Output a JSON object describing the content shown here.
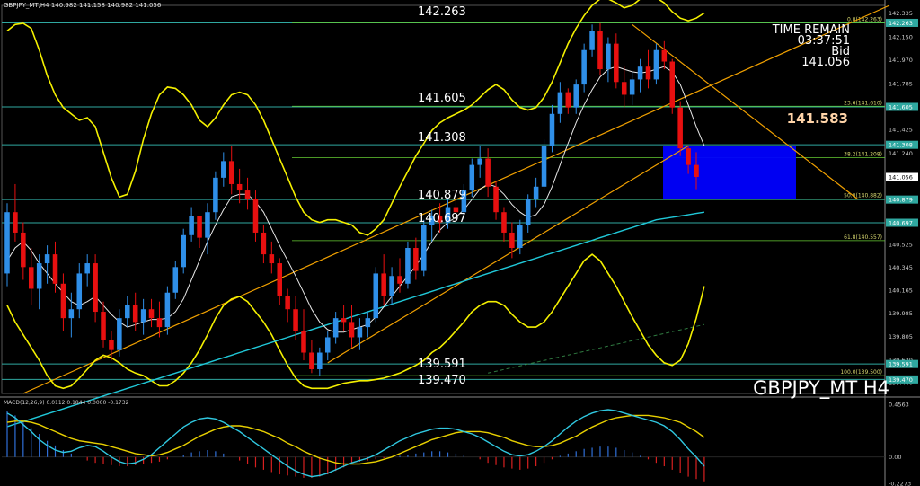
{
  "header": {
    "title": "GBPJPY_MT,H4  140.982 141.158 140.982 141.056"
  },
  "timer": {
    "label": "TIME REMAIN",
    "time": "03:37:51",
    "side": "Bid",
    "price": "141.056"
  },
  "current_price_big": "141.583",
  "symbol": "GBPJPY_MT H4",
  "macd_header": "MACD(12,26,9) 0.0112 0.1844 0.0000 -0.1732",
  "level_labels": [
    "142.263",
    "141.605",
    "141.308",
    "140.879",
    "140.697",
    "139.591",
    "139.470"
  ],
  "fib_labels": [
    "0.0(142.263)",
    "23.6(141.610)",
    "38.2(141.208)",
    "50.0(140.882)",
    "61.8(140.557)",
    "100.0(139.500)"
  ],
  "price_axis": {
    "ticks": [
      "142.335",
      "142.150",
      "141.970",
      "141.785",
      "141.605",
      "141.425",
      "141.240",
      "141.056",
      "140.875",
      "140.690",
      "140.525",
      "140.345",
      "140.165",
      "139.985",
      "139.805",
      "139.620",
      "139.440"
    ],
    "badges": [
      "142.263",
      "141.605",
      "141.308",
      "141.056",
      "140.879",
      "140.697",
      "139.591",
      "139.470"
    ]
  },
  "macd_axis": {
    "ticks": [
      "0.4563",
      "0.00",
      "-0.2273"
    ]
  },
  "colors": {
    "bull": "#2f8fe8",
    "bear": "#e81010",
    "bollinger": "#f4f000",
    "ma_fast": "#e8e8e8",
    "ma_slow": "#20c8d8",
    "trend": "#f0a000",
    "hline": "#2fa8a0",
    "fib": "#66cc33",
    "zone": "#0000ff",
    "macd_signal": "#e8d000",
    "macd_line": "#30c8e0"
  },
  "chart_data": {
    "type": "candlestick",
    "title": "GBPJPY_MT H4",
    "ylim": [
      139.36,
      142.4
    ],
    "levels": [
      142.263,
      141.605,
      141.308,
      140.879,
      140.697,
      139.591,
      139.47
    ],
    "fibonacci": [
      {
        "ratio": 0.0,
        "price": 142.263
      },
      {
        "ratio": 23.6,
        "price": 141.61
      },
      {
        "ratio": 38.2,
        "price": 141.208
      },
      {
        "ratio": 50.0,
        "price": 140.882
      },
      {
        "ratio": 61.8,
        "price": 140.557
      },
      {
        "ratio": 100.0,
        "price": 139.5
      }
    ],
    "candles": [
      [
        140.3,
        140.85,
        140.2,
        140.78
      ],
      [
        140.78,
        141.0,
        140.55,
        140.62
      ],
      [
        140.62,
        140.7,
        140.25,
        140.35
      ],
      [
        140.35,
        140.5,
        140.05,
        140.18
      ],
      [
        140.18,
        140.45,
        140.02,
        140.38
      ],
      [
        140.38,
        140.52,
        140.22,
        140.45
      ],
      [
        140.45,
        140.55,
        140.15,
        140.22
      ],
      [
        140.22,
        140.3,
        139.85,
        139.95
      ],
      [
        139.95,
        140.15,
        139.8,
        140.02
      ],
      [
        140.02,
        140.38,
        139.95,
        140.3
      ],
      [
        140.3,
        140.45,
        140.2,
        140.38
      ],
      [
        140.38,
        140.45,
        139.92,
        140.0
      ],
      [
        140.0,
        140.08,
        139.72,
        139.78
      ],
      [
        139.78,
        139.85,
        139.62,
        139.7
      ],
      [
        139.7,
        140.02,
        139.65,
        139.95
      ],
      [
        139.95,
        140.12,
        139.88,
        140.05
      ],
      [
        140.05,
        140.15,
        139.85,
        139.92
      ],
      [
        139.92,
        140.1,
        139.82,
        140.02
      ],
      [
        140.02,
        140.1,
        139.88,
        139.95
      ],
      [
        139.95,
        140.08,
        139.8,
        139.88
      ],
      [
        139.88,
        140.2,
        139.82,
        140.15
      ],
      [
        140.15,
        140.4,
        140.1,
        140.35
      ],
      [
        140.35,
        140.65,
        140.3,
        140.6
      ],
      [
        140.6,
        140.82,
        140.55,
        140.75
      ],
      [
        140.75,
        140.72,
        140.5,
        140.58
      ],
      [
        140.58,
        140.85,
        140.45,
        140.78
      ],
      [
        140.78,
        141.1,
        140.72,
        141.05
      ],
      [
        141.05,
        141.25,
        140.98,
        141.18
      ],
      [
        141.18,
        141.3,
        140.92,
        141.0
      ],
      [
        141.0,
        141.12,
        140.85,
        140.95
      ],
      [
        140.95,
        141.05,
        140.8,
        140.88
      ],
      [
        140.88,
        140.95,
        140.55,
        140.62
      ],
      [
        140.62,
        140.68,
        140.38,
        140.45
      ],
      [
        140.45,
        140.55,
        140.3,
        140.38
      ],
      [
        140.38,
        140.42,
        140.05,
        140.12
      ],
      [
        140.12,
        140.18,
        139.92,
        140.02
      ],
      [
        140.02,
        140.12,
        139.78,
        139.85
      ],
      [
        139.85,
        140.02,
        139.62,
        139.68
      ],
      [
        139.68,
        139.78,
        139.52,
        139.55
      ],
      [
        139.55,
        139.72,
        139.5,
        139.68
      ],
      [
        139.68,
        139.85,
        139.62,
        139.8
      ],
      [
        139.8,
        140.0,
        139.75,
        139.95
      ],
      [
        139.95,
        140.05,
        139.85,
        139.92
      ],
      [
        139.92,
        140.05,
        139.72,
        139.8
      ],
      [
        139.8,
        139.95,
        139.7,
        139.88
      ],
      [
        139.88,
        140.0,
        139.8,
        139.95
      ],
      [
        139.95,
        140.35,
        139.92,
        140.3
      ],
      [
        140.3,
        140.45,
        140.05,
        140.12
      ],
      [
        140.12,
        140.35,
        140.05,
        140.28
      ],
      [
        140.28,
        140.42,
        140.15,
        140.22
      ],
      [
        140.22,
        140.55,
        140.18,
        140.5
      ],
      [
        140.5,
        140.58,
        140.25,
        140.32
      ],
      [
        140.32,
        140.72,
        140.28,
        140.68
      ],
      [
        140.68,
        140.8,
        140.55,
        140.75
      ],
      [
        140.75,
        140.85,
        140.62,
        140.7
      ],
      [
        140.7,
        140.88,
        140.65,
        140.82
      ],
      [
        140.82,
        140.95,
        140.7,
        140.78
      ],
      [
        140.78,
        141.0,
        140.72,
        140.95
      ],
      [
        140.95,
        141.2,
        140.9,
        141.15
      ],
      [
        141.15,
        141.3,
        141.05,
        141.2
      ],
      [
        141.2,
        141.28,
        140.9,
        140.98
      ],
      [
        140.98,
        141.02,
        140.72,
        140.78
      ],
      [
        140.78,
        140.82,
        140.55,
        140.62
      ],
      [
        140.62,
        140.7,
        140.42,
        140.5
      ],
      [
        140.5,
        140.72,
        140.45,
        140.68
      ],
      [
        140.68,
        140.92,
        140.62,
        140.88
      ],
      [
        140.88,
        141.05,
        140.82,
        140.98
      ],
      [
        140.98,
        141.35,
        140.95,
        141.3
      ],
      [
        141.3,
        141.62,
        141.25,
        141.55
      ],
      [
        141.55,
        141.8,
        141.48,
        141.72
      ],
      [
        141.72,
        141.75,
        141.55,
        141.6
      ],
      [
        141.6,
        141.82,
        141.55,
        141.78
      ],
      [
        141.78,
        142.1,
        141.72,
        142.05
      ],
      [
        142.05,
        142.25,
        142.0,
        142.2
      ],
      [
        142.2,
        142.26,
        141.85,
        141.9
      ],
      [
        141.9,
        142.15,
        141.8,
        142.1
      ],
      [
        142.1,
        142.18,
        141.75,
        141.8
      ],
      [
        141.8,
        141.92,
        141.6,
        141.7
      ],
      [
        141.7,
        141.88,
        141.62,
        141.82
      ],
      [
        141.82,
        141.98,
        141.72,
        141.92
      ],
      [
        141.92,
        142.05,
        141.75,
        141.82
      ],
      [
        141.82,
        142.1,
        141.78,
        142.05
      ],
      [
        142.05,
        142.12,
        141.9,
        141.96
      ],
      [
        141.96,
        141.98,
        141.55,
        141.6
      ],
      [
        141.6,
        141.65,
        141.22,
        141.28
      ],
      [
        141.28,
        141.3,
        141.08,
        141.15
      ],
      [
        141.15,
        141.25,
        140.96,
        141.056
      ]
    ],
    "bollinger_upper": [
      142.2,
      142.25,
      142.26,
      142.22,
      142.05,
      141.85,
      141.7,
      141.6,
      141.55,
      141.5,
      141.52,
      141.45,
      141.25,
      141.05,
      140.9,
      140.92,
      141.1,
      141.35,
      141.55,
      141.7,
      141.76,
      141.75,
      141.7,
      141.62,
      141.5,
      141.45,
      141.52,
      141.62,
      141.7,
      141.72,
      141.7,
      141.62,
      141.5,
      141.35,
      141.2,
      141.05,
      140.9,
      140.78,
      140.72,
      140.7,
      140.72,
      140.72,
      140.7,
      140.68,
      140.62,
      140.6,
      140.65,
      140.72,
      140.85,
      140.98,
      141.1,
      141.22,
      141.32,
      141.42,
      141.48,
      141.52,
      141.55,
      141.58,
      141.62,
      141.68,
      141.74,
      141.78,
      141.74,
      141.66,
      141.6,
      141.58,
      141.6,
      141.68,
      141.8,
      141.95,
      142.1,
      142.22,
      142.32,
      142.4,
      142.45,
      142.45,
      142.42,
      142.38,
      142.4,
      142.45,
      142.48,
      142.46,
      142.42,
      142.35,
      142.3,
      142.28,
      142.3,
      142.34
    ],
    "bollinger_lower": [
      140.05,
      139.92,
      139.82,
      139.72,
      139.62,
      139.5,
      139.42,
      139.4,
      139.42,
      139.48,
      139.55,
      139.62,
      139.66,
      139.64,
      139.6,
      139.55,
      139.52,
      139.5,
      139.46,
      139.42,
      139.42,
      139.46,
      139.52,
      139.6,
      139.7,
      139.82,
      139.95,
      140.05,
      140.1,
      140.12,
      140.08,
      140.0,
      139.92,
      139.82,
      139.7,
      139.58,
      139.48,
      139.42,
      139.4,
      139.4,
      139.4,
      139.42,
      139.44,
      139.45,
      139.46,
      139.46,
      139.47,
      139.48,
      139.5,
      139.52,
      139.55,
      139.58,
      139.62,
      139.68,
      139.72,
      139.78,
      139.85,
      139.92,
      140.0,
      140.05,
      140.08,
      140.08,
      140.05,
      139.98,
      139.92,
      139.88,
      139.88,
      139.92,
      140.0,
      140.1,
      140.2,
      140.3,
      140.4,
      140.45,
      140.4,
      140.3,
      140.2,
      140.08,
      139.96,
      139.85,
      139.74,
      139.66,
      139.6,
      139.58,
      139.62,
      139.75,
      139.95,
      140.2
    ],
    "ma_fast": [
      140.4,
      140.5,
      140.55,
      140.48,
      140.38,
      140.3,
      140.22,
      140.15,
      140.08,
      140.05,
      140.08,
      140.12,
      140.05,
      139.98,
      139.92,
      139.88,
      139.9,
      139.92,
      139.94,
      139.94,
      139.95,
      140.0,
      140.1,
      140.25,
      140.4,
      140.55,
      140.68,
      140.8,
      140.9,
      140.92,
      140.92,
      140.86,
      140.78,
      140.65,
      140.52,
      140.4,
      140.28,
      140.15,
      140.02,
      139.92,
      139.86,
      139.84,
      139.84,
      139.86,
      139.88,
      139.9,
      139.96,
      140.04,
      140.12,
      140.2,
      140.28,
      140.36,
      140.45,
      140.55,
      140.64,
      140.7,
      140.74,
      140.8,
      140.88,
      140.96,
      141.0,
      140.98,
      140.92,
      140.84,
      140.78,
      140.74,
      140.76,
      140.84,
      140.98,
      141.15,
      141.32,
      141.48,
      141.62,
      141.74,
      141.84,
      141.9,
      141.92,
      141.9,
      141.88,
      141.87,
      141.88,
      141.9,
      141.92,
      141.88,
      141.78,
      141.62,
      141.45,
      141.3
    ],
    "ma_slow": [
      139.1,
      139.12,
      139.14,
      139.16,
      139.18,
      139.2,
      139.22,
      139.24,
      139.26,
      139.28,
      139.3,
      139.32,
      139.34,
      139.36,
      139.38,
      139.4,
      139.42,
      139.44,
      139.46,
      139.48,
      139.5,
      139.52,
      139.54,
      139.56,
      139.58,
      139.6,
      139.62,
      139.64,
      139.66,
      139.68,
      139.7,
      139.72,
      139.74,
      139.76,
      139.78,
      139.8,
      139.82,
      139.84,
      139.86,
      139.88,
      139.9,
      139.92,
      139.94,
      139.96,
      139.98,
      140.0,
      140.02,
      140.04,
      140.06,
      140.08,
      140.1,
      140.12,
      140.14,
      140.16,
      140.18,
      140.2,
      140.22,
      140.24,
      140.26,
      140.28,
      140.3,
      140.32,
      140.34,
      140.36,
      140.38,
      140.4,
      140.42,
      140.44,
      140.46,
      140.48,
      140.5,
      140.52,
      140.54,
      140.56,
      140.58,
      140.6,
      140.62,
      140.64,
      140.66,
      140.68,
      140.7,
      140.72,
      140.73,
      140.74,
      140.75,
      140.76,
      140.77,
      140.78
    ],
    "macd_hist": [
      0.38,
      0.34,
      0.28,
      0.22,
      0.15,
      0.1,
      0.06,
      0.04,
      0.05,
      0.08,
      0.1,
      0.09,
      0.05,
      0.0,
      -0.04,
      -0.06,
      -0.05,
      -0.02,
      0.02,
      0.08,
      0.14,
      0.2,
      0.26,
      0.3,
      0.33,
      0.34,
      0.33,
      0.3,
      0.26,
      0.22,
      0.17,
      0.12,
      0.07,
      0.02,
      -0.03,
      -0.08,
      -0.12,
      -0.15,
      -0.17,
      -0.16,
      -0.14,
      -0.11,
      -0.08,
      -0.05,
      -0.03,
      -0.01,
      0.02,
      0.06,
      0.1,
      0.14,
      0.17,
      0.2,
      0.22,
      0.24,
      0.25,
      0.25,
      0.24,
      0.22,
      0.2,
      0.17,
      0.13,
      0.09,
      0.05,
      0.02,
      0.01,
      0.02,
      0.05,
      0.09,
      0.14,
      0.2,
      0.26,
      0.31,
      0.35,
      0.38,
      0.4,
      0.41,
      0.4,
      0.38,
      0.36,
      0.34,
      0.32,
      0.3,
      0.27,
      0.22,
      0.15,
      0.07,
      0.0,
      -0.08
    ],
    "macd_signal": [
      0.3,
      0.31,
      0.31,
      0.3,
      0.28,
      0.25,
      0.22,
      0.19,
      0.16,
      0.14,
      0.13,
      0.12,
      0.11,
      0.09,
      0.07,
      0.05,
      0.03,
      0.02,
      0.01,
      0.02,
      0.04,
      0.07,
      0.1,
      0.14,
      0.18,
      0.21,
      0.24,
      0.26,
      0.27,
      0.27,
      0.26,
      0.24,
      0.22,
      0.19,
      0.16,
      0.12,
      0.09,
      0.05,
      0.02,
      -0.01,
      -0.03,
      -0.05,
      -0.06,
      -0.06,
      -0.06,
      -0.05,
      -0.04,
      -0.02,
      0.0,
      0.03,
      0.06,
      0.09,
      0.12,
      0.15,
      0.17,
      0.19,
      0.21,
      0.22,
      0.22,
      0.22,
      0.21,
      0.19,
      0.17,
      0.14,
      0.12,
      0.1,
      0.09,
      0.09,
      0.1,
      0.12,
      0.15,
      0.18,
      0.22,
      0.26,
      0.29,
      0.32,
      0.34,
      0.35,
      0.36,
      0.36,
      0.36,
      0.35,
      0.34,
      0.32,
      0.3,
      0.26,
      0.22,
      0.17
    ],
    "macd_bars": [
      0.4,
      0.36,
      0.3,
      0.25,
      0.2,
      0.14,
      0.1,
      0.06,
      0.03,
      0.0,
      -0.03,
      -0.05,
      -0.06,
      -0.07,
      -0.08,
      -0.08,
      -0.07,
      -0.06,
      -0.05,
      -0.04,
      -0.02,
      0.0,
      0.02,
      0.04,
      0.05,
      0.06,
      0.05,
      0.03,
      0.0,
      -0.03,
      -0.06,
      -0.09,
      -0.11,
      -0.13,
      -0.15,
      -0.16,
      -0.17,
      -0.18,
      -0.18,
      -0.17,
      -0.15,
      -0.12,
      -0.09,
      -0.06,
      -0.04,
      -0.03,
      -0.02,
      -0.01,
      0.0,
      0.01,
      0.02,
      0.03,
      0.04,
      0.05,
      0.05,
      0.04,
      0.03,
      0.02,
      0.0,
      -0.02,
      -0.05,
      -0.07,
      -0.09,
      -0.1,
      -0.11,
      -0.1,
      -0.08,
      -0.05,
      -0.02,
      0.01,
      0.03,
      0.05,
      0.07,
      0.08,
      0.09,
      0.09,
      0.08,
      0.06,
      0.04,
      0.01,
      -0.02,
      -0.05,
      -0.08,
      -0.11,
      -0.14,
      -0.17,
      -0.19,
      -0.21
    ],
    "macd_ylim": [
      -0.2273,
      0.4563
    ]
  }
}
